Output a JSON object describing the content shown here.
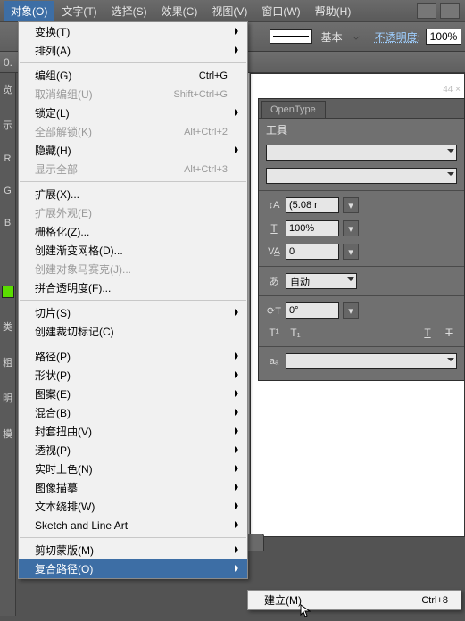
{
  "menubar": {
    "items": [
      "对象(O)",
      "文字(T)",
      "选择(S)",
      "效果(C)",
      "视图(V)",
      "窗口(W)",
      "帮助(H)"
    ]
  },
  "controlbar": {
    "basic": "基本",
    "opacity_label": "不透明度:",
    "opacity_value": "100%"
  },
  "subbar": {
    "text": "0."
  },
  "left": {
    "labels": [
      "览",
      "示",
      "R",
      "G",
      "B",
      "类",
      "粗",
      "明",
      "模"
    ]
  },
  "panel": {
    "flyhead": "44    ×",
    "tabs": [
      "OpenType"
    ],
    "tool_label": "工具",
    "leading": "(5.08 r",
    "scale": "100%",
    "tracking": "0",
    "auto": "自动",
    "rotate": "0°",
    "aa": "aₐ"
  },
  "dropdown": [
    {
      "t": "变换(T)",
      "sub": true
    },
    {
      "t": "排列(A)",
      "sub": true
    },
    {
      "sep": true
    },
    {
      "t": "编组(G)",
      "k": "Ctrl+G"
    },
    {
      "t": "取消编组(U)",
      "k": "Shift+Ctrl+G",
      "dis": true
    },
    {
      "t": "锁定(L)",
      "sub": true
    },
    {
      "t": "全部解锁(K)",
      "k": "Alt+Ctrl+2",
      "dis": true
    },
    {
      "t": "隐藏(H)",
      "sub": true
    },
    {
      "t": "显示全部",
      "k": "Alt+Ctrl+3",
      "dis": true
    },
    {
      "sep": true
    },
    {
      "t": "扩展(X)..."
    },
    {
      "t": "扩展外观(E)",
      "dis": true
    },
    {
      "t": "栅格化(Z)..."
    },
    {
      "t": "创建渐变网格(D)..."
    },
    {
      "t": "创建对象马赛克(J)...",
      "dis": true
    },
    {
      "t": "拼合透明度(F)..."
    },
    {
      "sep": true
    },
    {
      "t": "切片(S)",
      "sub": true
    },
    {
      "t": "创建裁切标记(C)"
    },
    {
      "sep": true
    },
    {
      "t": "路径(P)",
      "sub": true
    },
    {
      "t": "形状(P)",
      "sub": true
    },
    {
      "t": "图案(E)",
      "sub": true
    },
    {
      "t": "混合(B)",
      "sub": true
    },
    {
      "t": "封套扭曲(V)",
      "sub": true
    },
    {
      "t": "透视(P)",
      "sub": true
    },
    {
      "t": "实时上色(N)",
      "sub": true
    },
    {
      "t": "图像描摹",
      "sub": true
    },
    {
      "t": "文本绕排(W)",
      "sub": true
    },
    {
      "t": "Sketch and Line Art",
      "sub": true
    },
    {
      "sep": true
    },
    {
      "t": "剪切蒙版(M)",
      "sub": true
    },
    {
      "t": "复合路径(O)",
      "sub": true,
      "hl": true
    }
  ],
  "submenu": [
    {
      "t": "建立(M)",
      "k": "Ctrl+8"
    }
  ]
}
